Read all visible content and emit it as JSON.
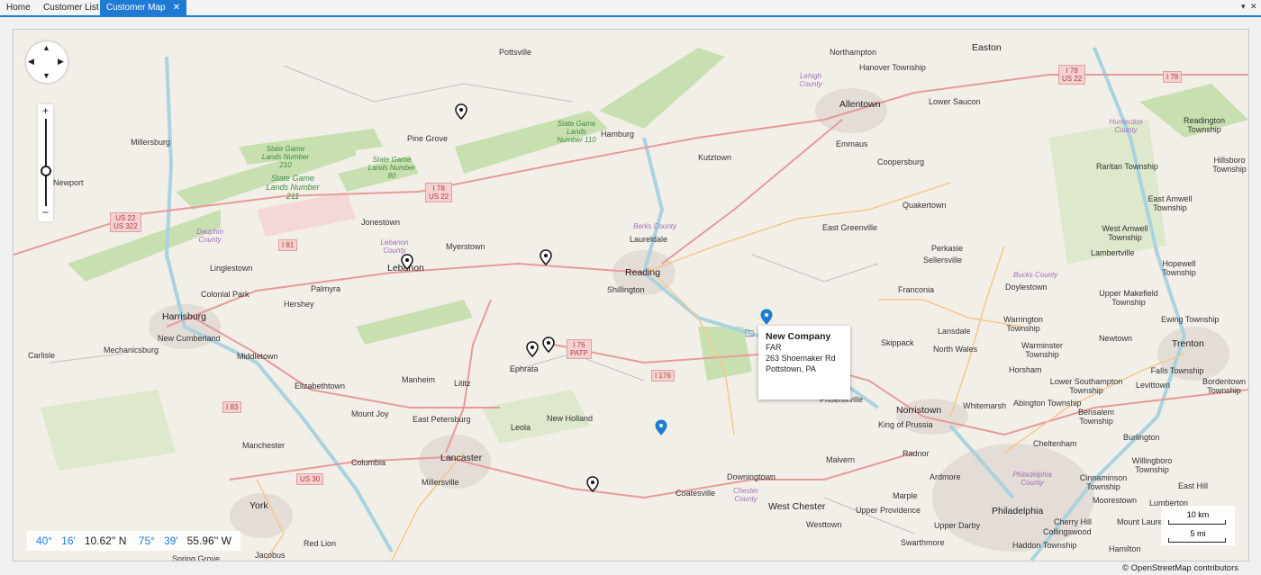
{
  "tabs": [
    {
      "label": "Home"
    },
    {
      "label": "Customer List"
    },
    {
      "label": "Customer Map"
    }
  ],
  "tab_controls": {
    "dropdown": "▾",
    "close": "✕"
  },
  "map": {
    "zoom_controls": {
      "plus": "+",
      "minus": "−"
    },
    "pan_arrows": {
      "up": "▲",
      "down": "▼",
      "left": "◀",
      "right": "▶"
    },
    "popup": {
      "title": "New Company",
      "line1": "FAR",
      "line2": "263 Shoemaker Rd",
      "line3": "Pottstown, PA"
    },
    "coordinates": {
      "lat_deg": "40°",
      "lat_min": "16'",
      "lat_sec": "10.62'' N",
      "lon_deg": "75°",
      "lon_min": "39'",
      "lon_sec": "55.96'' W"
    },
    "scale": {
      "km": "10 km",
      "mi": "5 mi"
    },
    "attribution": "© OpenStreetMap contributors",
    "labels": {
      "pottsville": "Pottsville",
      "northampton": "Northampton",
      "easton": "Easton",
      "hanover": "Hanover Township",
      "allentown": "Allentown",
      "lower_saucon": "Lower Saucon",
      "pine_grove": "Pine Grove",
      "hamburg": "Hamburg",
      "millersburg": "Millersburg",
      "newport": "Newport",
      "kutztown": "Kutztown",
      "emmaus": "Emmaus",
      "coopersburg": "Coopersburg",
      "quakertown": "Quakertown",
      "jonestown": "Jonestown",
      "myerstown": "Myerstown",
      "laureldale": "Laureldale",
      "east_greenville": "East Greenville",
      "lebanon": "Lebanon",
      "linglestown": "Linglestown",
      "reading": "Reading",
      "shillington": "Shillington",
      "palmyra": "Palmyra",
      "colonial_park": "Colonial Park",
      "hershey": "Hershey",
      "harrisburg": "Harrisburg",
      "perkasie": "Perkasie",
      "sellersville": "Sellersville",
      "franconia": "Franconia",
      "doylestown": "Doylestown",
      "new_cumberland": "New Cumberland",
      "mechanicsburg": "Mechanicsburg",
      "carlisle": "Carlisle",
      "middletown": "Middletown",
      "ephrata": "Ephrata",
      "manheim": "Manheim",
      "lititz": "Lititz",
      "elizabethtown": "Elizabethtown",
      "mount_joy": "Mount Joy",
      "east_petersburg": "East Petersburg",
      "leola": "Leola",
      "new_holland": "New Holland",
      "skippack": "Skippack",
      "lansdale": "Lansdale",
      "north_wales": "North Wales",
      "horsham": "Horsham",
      "norristown": "Norristown",
      "king_of_prussia": "King of Prussia",
      "phoenixville": "Phoenixville",
      "whitemarsh": "Whitemarsh",
      "abington": "Abington Township",
      "manchester": "Manchester",
      "columbia": "Columbia",
      "lancaster": "Lancaster",
      "millersville": "Millersville",
      "malvern": "Malvern",
      "radnor": "Radnor",
      "ardmore": "Ardmore",
      "downingtown": "Downingtown",
      "coatesville": "Coatesville",
      "west_chester": "West Chester",
      "york": "York",
      "red_lion": "Red Lion",
      "marple": "Marple",
      "upper_providence": "Upper Providence",
      "philadelphia": "Philadelphia",
      "trenton": "Trenton",
      "upper_darby": "Upper Darby",
      "cherry_hill": "Cherry Hill",
      "mount_laurel": "Mount Laurel",
      "lumberton": "Lumberton",
      "westtown": "Westtown",
      "swarthmore": "Swarthmore",
      "haddon": "Haddon Township",
      "jacobus": "Jacobus",
      "spring_grove": "Spring Grove",
      "bensalem": "Bensalem Township",
      "burlington": "Burlington",
      "willingboro": "Willingboro Township",
      "levittown": "Levittown",
      "newtown": "Newtown",
      "lambertville": "Lambertville",
      "readington": "Readington Township",
      "raritan": "Raritan Township",
      "hillsborough": "Hillsboro Township",
      "east_amwell": "East Amwell Township",
      "west_amwell": "West Amwell Township",
      "hopewell": "Hopewell Township",
      "upper_makefield": "Upper Makefield Township",
      "ewing": "Ewing Township",
      "falls": "Falls Township",
      "bordentown": "Bordentown Township",
      "warrington": "Warrington Township",
      "warminster": "Warminster Township",
      "lower_southampton": "Lower Southampton Township",
      "cheltenham": "Cheltenham",
      "cinnaminson": "Cinnaminson Township",
      "moorestown": "Moorestown",
      "collingswood": "Collingswood",
      "hamilton": "Hamilton",
      "east_hill": "East Hill",
      "sg210": "State Game Lands Number 210",
      "sg211": "State Game Lands Number 211",
      "sg80": "State Game Lands Number 80",
      "sg110": "State Game Lands Number 110",
      "lehigh_county": "Lehigh County",
      "berks_county": "Berks County",
      "lebanon_county": "Lebanon County",
      "dauphin_county": "Dauphin County",
      "bucks_county": "Bucks County",
      "chester_county": "Chester County",
      "hunterdon_county": "Hunterdon County",
      "philadelphia_county": "Philadelphia County"
    },
    "shields": {
      "i78_us22_west": "I 78\nUS 22",
      "i78_us22_east": "I 78\nUS 22",
      "i78_east": "I 78",
      "us22_us322": "US 22\nUS 322",
      "i81": "I 81",
      "i76_patp": "I 76\nPATP",
      "i176": "I 176",
      "i83": "I 83",
      "us30": "US 30"
    }
  }
}
